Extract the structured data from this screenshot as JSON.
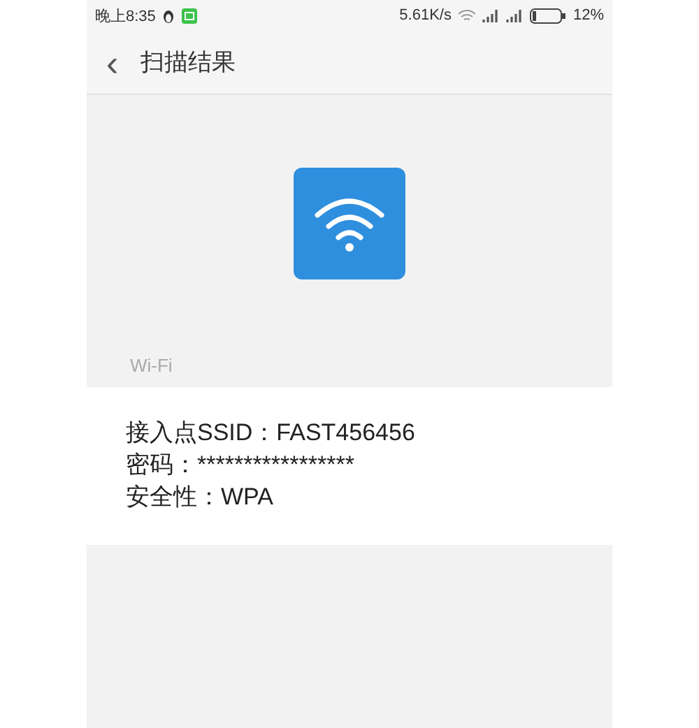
{
  "status_bar": {
    "time": "晚上8:35",
    "speed": "5.61K/s",
    "battery": "12%"
  },
  "header": {
    "back": "‹",
    "title": "扫描结果"
  },
  "result": {
    "type": "Wi-Fi",
    "lines": [
      "接入点SSID：FAST456456",
      "密码：*****************",
      "安全性：WPA"
    ]
  }
}
